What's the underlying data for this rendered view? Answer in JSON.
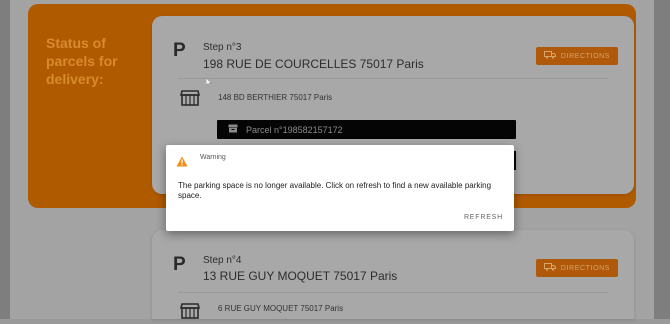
{
  "status": {
    "title": "Status of parcels for delivery:"
  },
  "steps": [
    {
      "label": "Step n°3",
      "address": "198 RUE DE COURCELLES 75017 Paris",
      "directions_label": "DIRECTIONS",
      "store_address": "148 BD BERTHIER 75017 Paris",
      "parcel_label": "Parcel n°198582157172"
    },
    {
      "label": "Step n°4",
      "address": "13 RUE GUY MOQUET 75017 Paris",
      "directions_label": "DIRECTIONS",
      "store_address": "6 RUE GUY MOQUET 75017 Paris"
    }
  ],
  "dialog": {
    "title": "Warning",
    "message": "The parking space is no longer available. Click on refresh to find a new available parking space.",
    "refresh_label": "REFRESH"
  },
  "icons": {
    "parking": "P",
    "warning": "warning-triangle-icon",
    "store": "store-icon",
    "van": "van-icon",
    "box": "box-icon"
  },
  "colors": {
    "accent": "#b05a00",
    "overlay": "#9a9a9a",
    "warning": "#f08c1a"
  }
}
